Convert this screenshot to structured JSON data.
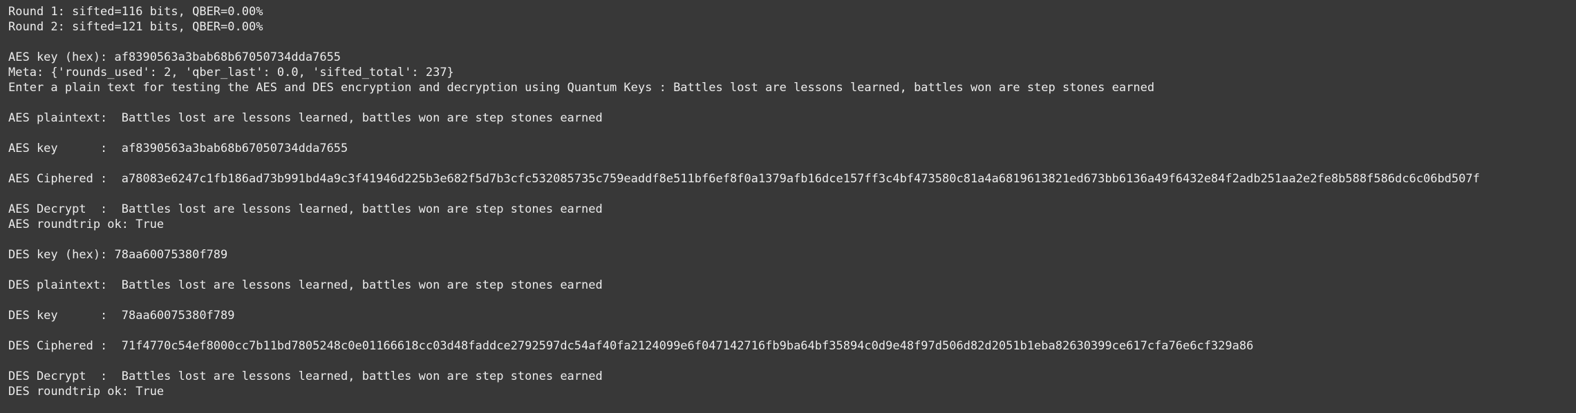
{
  "theme": {
    "background": "#383838",
    "text": "#ececec"
  },
  "output": {
    "round1": "Round 1: sifted=116 bits, QBER=0.00%",
    "round2": "Round 2: sifted=121 bits, QBER=0.00%",
    "aes_key_hex": "AES key (hex): af8390563a3bab68b67050734dda7655",
    "meta": "Meta: {'rounds_used': 2, 'qber_last': 0.0, 'sifted_total': 237}",
    "prompt": "Enter a plain text for testing the AES and DES encryption and decryption using Quantum Keys : Battles lost are lessons learned, battles won are step stones earned",
    "aes_plaintext": "AES plaintext:  Battles lost are lessons learned, battles won are step stones earned",
    "aes_key": "AES key      :  af8390563a3bab68b67050734dda7655",
    "aes_ciphered": "AES Ciphered :  a78083e6247c1fb186ad73b991bd4a9c3f41946d225b3e682f5d7b3cfc532085735c759eaddf8e511bf6ef8f0a1379afb16dce157ff3c4bf473580c81a4a6819613821ed673bb6136a49f6432e84f2adb251aa2e2fe8b588f586dc6c06bd507f",
    "aes_decrypt": "AES Decrypt  :  Battles lost are lessons learned, battles won are step stones earned",
    "aes_roundtrip": "AES roundtrip ok: True",
    "des_key_hex": "DES key (hex): 78aa60075380f789",
    "des_plaintext": "DES plaintext:  Battles lost are lessons learned, battles won are step stones earned",
    "des_key": "DES key      :  78aa60075380f789",
    "des_ciphered": "DES Ciphered :  71f4770c54ef8000cc7b11bd7805248c0e01166618cc03d48faddce2792597dc54af40fa2124099e6f047142716fb9ba64bf35894c0d9e48f97d506d82d2051b1eba82630399ce617cfa76e6cf329a86",
    "des_decrypt": "DES Decrypt  :  Battles lost are lessons learned, battles won are step stones earned",
    "des_roundtrip": "DES roundtrip ok: True"
  }
}
